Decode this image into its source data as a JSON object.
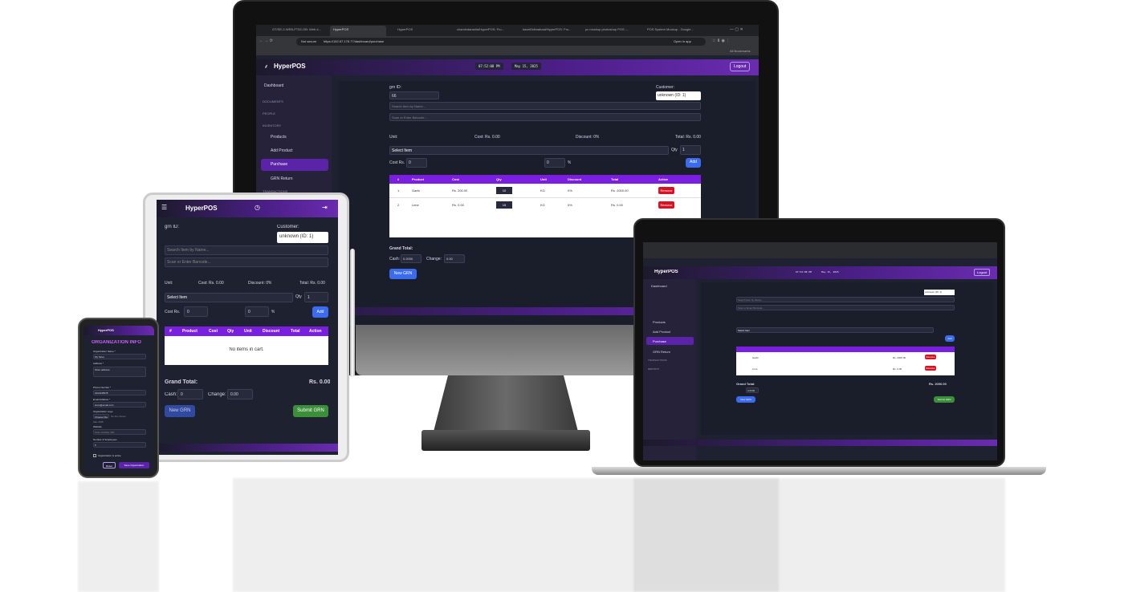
{
  "app": {
    "name": "HyperPOS"
  },
  "browser": {
    "tabs": [
      "GT/SE-2-WEB-FT52-OB: Web d...",
      "HyperPOS",
      "HyperPOS",
      "chamindaranila/HyperPOS: Fro...",
      "kaveli3dimabaal/HyperPOS: Fro...",
      "pc mockup photoshop POS -...",
      "POS System Mockup - Google..."
    ],
    "not_secure": "Not secure",
    "url": "https://152.67.178.77/dashboard/purchase",
    "open_in_app": "Open in app",
    "all_bookmarks": "All Bookmarks"
  },
  "header": {
    "time": "07:52:08 PM",
    "date": "May 15, 2025",
    "logout": "Logout"
  },
  "sidebar": {
    "dashboard": "Dashboard",
    "documents": "DOCUMENTS",
    "people": "PEOPLE",
    "inventory": "INVENTORY",
    "products": "Products",
    "add_product": "Add Product",
    "purchase": "Purchase",
    "grn_return": "GRN Return",
    "transactions": "TRANSACTIONS",
    "reports": "REPORTS"
  },
  "form": {
    "grn_id_label": "grn ID:",
    "grn_id_value": "66",
    "customer_label": "Customer:",
    "customer_value": "unknown (ID: 1)",
    "search_placeholder": "Search Item by Name...",
    "barcode_placeholder": "Scan or Enter Barcode...",
    "unit_label": "Unit:",
    "cost_label": "Cost: Rs. 0.00",
    "discount_label": "Discount: 0%",
    "total_label": "Total: Rs. 0.00",
    "select_item": "Select Item",
    "qty_label": "Qty",
    "qty_value": "1",
    "cost_rs_label": "Cost Rs.",
    "cost_rs_value": "0",
    "discount_value": "0",
    "percent": "%",
    "add": "Add",
    "grand_total": "Grand Total:",
    "cash_label": "Cash:",
    "cash_value": "0.2000",
    "change_label": "Change:",
    "change_value": "0.00",
    "new_grn": "New GRN",
    "submit_grn": "Submit GRN",
    "laptop_grand_total": "Rs. 2000.00",
    "laptop_cash_value": "0.0000"
  },
  "table": {
    "headers": [
      "#",
      "Product",
      "Cost",
      "Qty",
      "Unit",
      "Discount",
      "Total",
      "Action"
    ],
    "rows": [
      {
        "n": "1",
        "product": "Garlic",
        "cost": "Rs. 200.00",
        "qty": "10",
        "unit": "KG",
        "discount": "0%",
        "total": "Rs. 2000.00",
        "action": "Remove"
      },
      {
        "n": "2",
        "product": "Lime",
        "cost": "Rs. 0.00",
        "qty": "15",
        "unit": "KG",
        "discount": "0%",
        "total": "Rs. 0.00",
        "action": "Remove"
      }
    ]
  },
  "tablet": {
    "grn_id_label": "grn ID:",
    "customer_label": "Customer:",
    "customer_value": "unknown (ID: 1)",
    "search_placeholder": "Search Item by Name...",
    "barcode_placeholder": "Scan or Enter Barcode...",
    "unit_label": "Unit:",
    "cost_label": "Cost: Rs. 0.00",
    "discount_label": "Discount: 0%",
    "total_label": "Total: Rs. 0.00",
    "select_item": "Select Item",
    "qty_label": "Qty",
    "qty_value": "1",
    "cost_rs_label": "Cost Rs.",
    "cost_rs_value": "0",
    "discount_value": "0",
    "percent": "%",
    "add": "Add",
    "headers": [
      "#",
      "Product",
      "Cost",
      "Qty",
      "Unit",
      "Discount",
      "Total",
      "Action"
    ],
    "empty": "No items in cart.",
    "grand_total": "Grand Total:",
    "grand_total_value": "Rs. 0.00",
    "cash_label": "Cash:",
    "cash_value": "0",
    "change_label": "Change:",
    "change_value": "0.00",
    "new_grn": "New GRN",
    "submit_grn": "Submit GRN"
  },
  "phone": {
    "title": "ORGANIZATION INFO",
    "org_name_label": "Organization Name *",
    "org_name_value": "My Store",
    "address_label": "Address *",
    "address_value": "Store address",
    "phone_label": "Phone Number *",
    "phone_value": "0112345678",
    "email_label": "Email Address *",
    "email_value": "store@email.com",
    "logo_label": "Organization Logo",
    "choose_file": "Choose File",
    "no_file": "No file chosen",
    "logo_hint": "Max 2MB",
    "website_label": "Website",
    "website_value": "Store website URL",
    "employees_label": "Number of Employees",
    "employees_value": "5",
    "active_label": "Organization is active",
    "reset": "Reset",
    "save": "Save Organization"
  },
  "colors": {
    "purple": "#7a1fe0",
    "blue": "#3b6cf0",
    "red": "#d41424",
    "green": "#3b8f3b",
    "bg": "#1e2130"
  }
}
